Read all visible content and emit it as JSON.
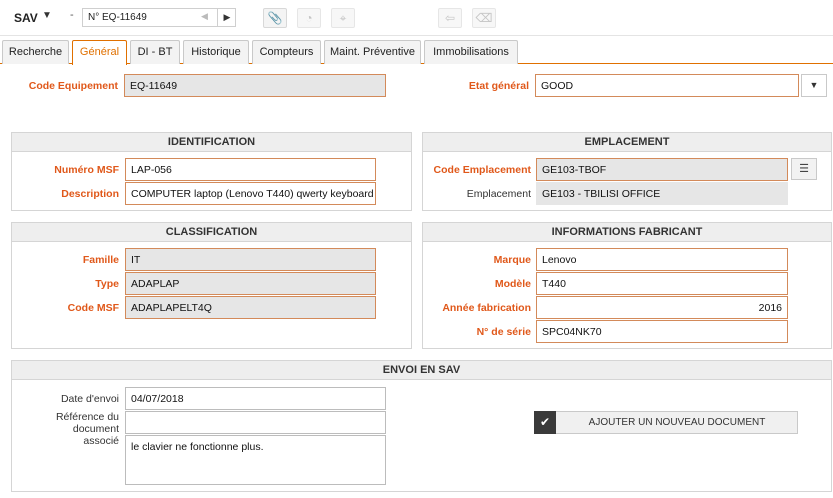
{
  "header": {
    "app_title": "SAV",
    "app_caret": "▼",
    "dash": "-",
    "record_label": "N° EQ-11649",
    "prev_glyph": "◀",
    "next_glyph": "▶",
    "icons": {
      "attach": "paperclip-icon",
      "chart": "pie-chart-icon",
      "map": "map-pin-icon",
      "back": "arrow-left-icon",
      "erase": "eraser-icon"
    },
    "attach_glyph": "📎",
    "chart_glyph": "◔",
    "map_glyph": "⌖",
    "back_glyph": "⇦",
    "erase_glyph": "⌫"
  },
  "tabs": [
    "Recherche",
    "Général",
    "DI - BT",
    "Historique",
    "Compteurs",
    "Maint. Préventive",
    "Immobilisations"
  ],
  "active_tab": "Général",
  "top": {
    "code_equipement_label": "Code Equipement",
    "code_equipement_value": "EQ-11649",
    "etat_label": "Etat général",
    "etat_value": "GOOD",
    "dropdown_glyph": "▼"
  },
  "identification": {
    "title": "IDENTIFICATION",
    "numero_label": "Numéro MSF",
    "numero_value": "LAP-056",
    "description_label": "Description",
    "description_value": "COMPUTER laptop (Lenovo T440) qwerty keyboard"
  },
  "emplacement": {
    "title": "EMPLACEMENT",
    "code_label": "Code Emplacement",
    "code_value": "GE103-TBOF",
    "emplacement_label": "Emplacement",
    "emplacement_value": "GE103 - TBILISI OFFICE",
    "lookup_glyph": "☰"
  },
  "classification": {
    "title": "CLASSIFICATION",
    "famille_label": "Famille",
    "famille_value": "IT",
    "type_label": "Type",
    "type_value": "ADAPLAP",
    "code_label": "Code MSF",
    "code_value": "ADAPLAPELT4Q"
  },
  "fabricant": {
    "title": "INFORMATIONS FABRICANT",
    "marque_label": "Marque",
    "marque_value": "Lenovo",
    "modele_label": "Modèle",
    "modele_value": "T440",
    "annee_label": "Année fabrication",
    "annee_value": "2016",
    "serie_label": "N° de série",
    "serie_value": "SPC04NK70"
  },
  "envoi": {
    "title": "ENVOI EN SAV",
    "date_label": "Date d'envoi",
    "date_value": "04/07/2018",
    "ref_label_1": "Référence du document",
    "ref_label_2": "associé",
    "ref_value": "",
    "comment_value": "le clavier ne fonctionne plus.",
    "add_doc_label": "AJOUTER UN NOUVEAU DOCUMENT",
    "check_glyph": "✔"
  },
  "colors": {
    "accent": "#e07000",
    "required_label": "#e0581a",
    "field_border": "#d38a5a",
    "readonly_bg": "#e6e6e6"
  }
}
